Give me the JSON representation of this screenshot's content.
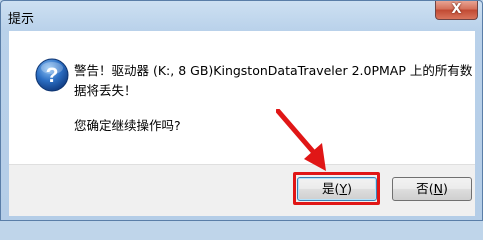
{
  "window": {
    "title": "提示",
    "close_label": "X"
  },
  "message": {
    "line1": "警告！驱动器 (K:, 8 GB)KingstonDataTraveler 2.0PMAP 上的所有数",
    "line2": "据将丢失！",
    "confirm": "您确定继续操作吗?"
  },
  "buttons": {
    "yes_label": "是",
    "yes_key_open": "(",
    "yes_key": "Y",
    "yes_key_close": ")",
    "no_label": "否",
    "no_key_open": "(",
    "no_key": "N",
    "no_key_close": ")"
  },
  "colors": {
    "highlight": "#e01616",
    "icon_blue": "#1f5fb0"
  },
  "icons": {
    "dialog_icon": "question-icon",
    "close": "close-icon",
    "annotation": "red-arrow-icon"
  }
}
